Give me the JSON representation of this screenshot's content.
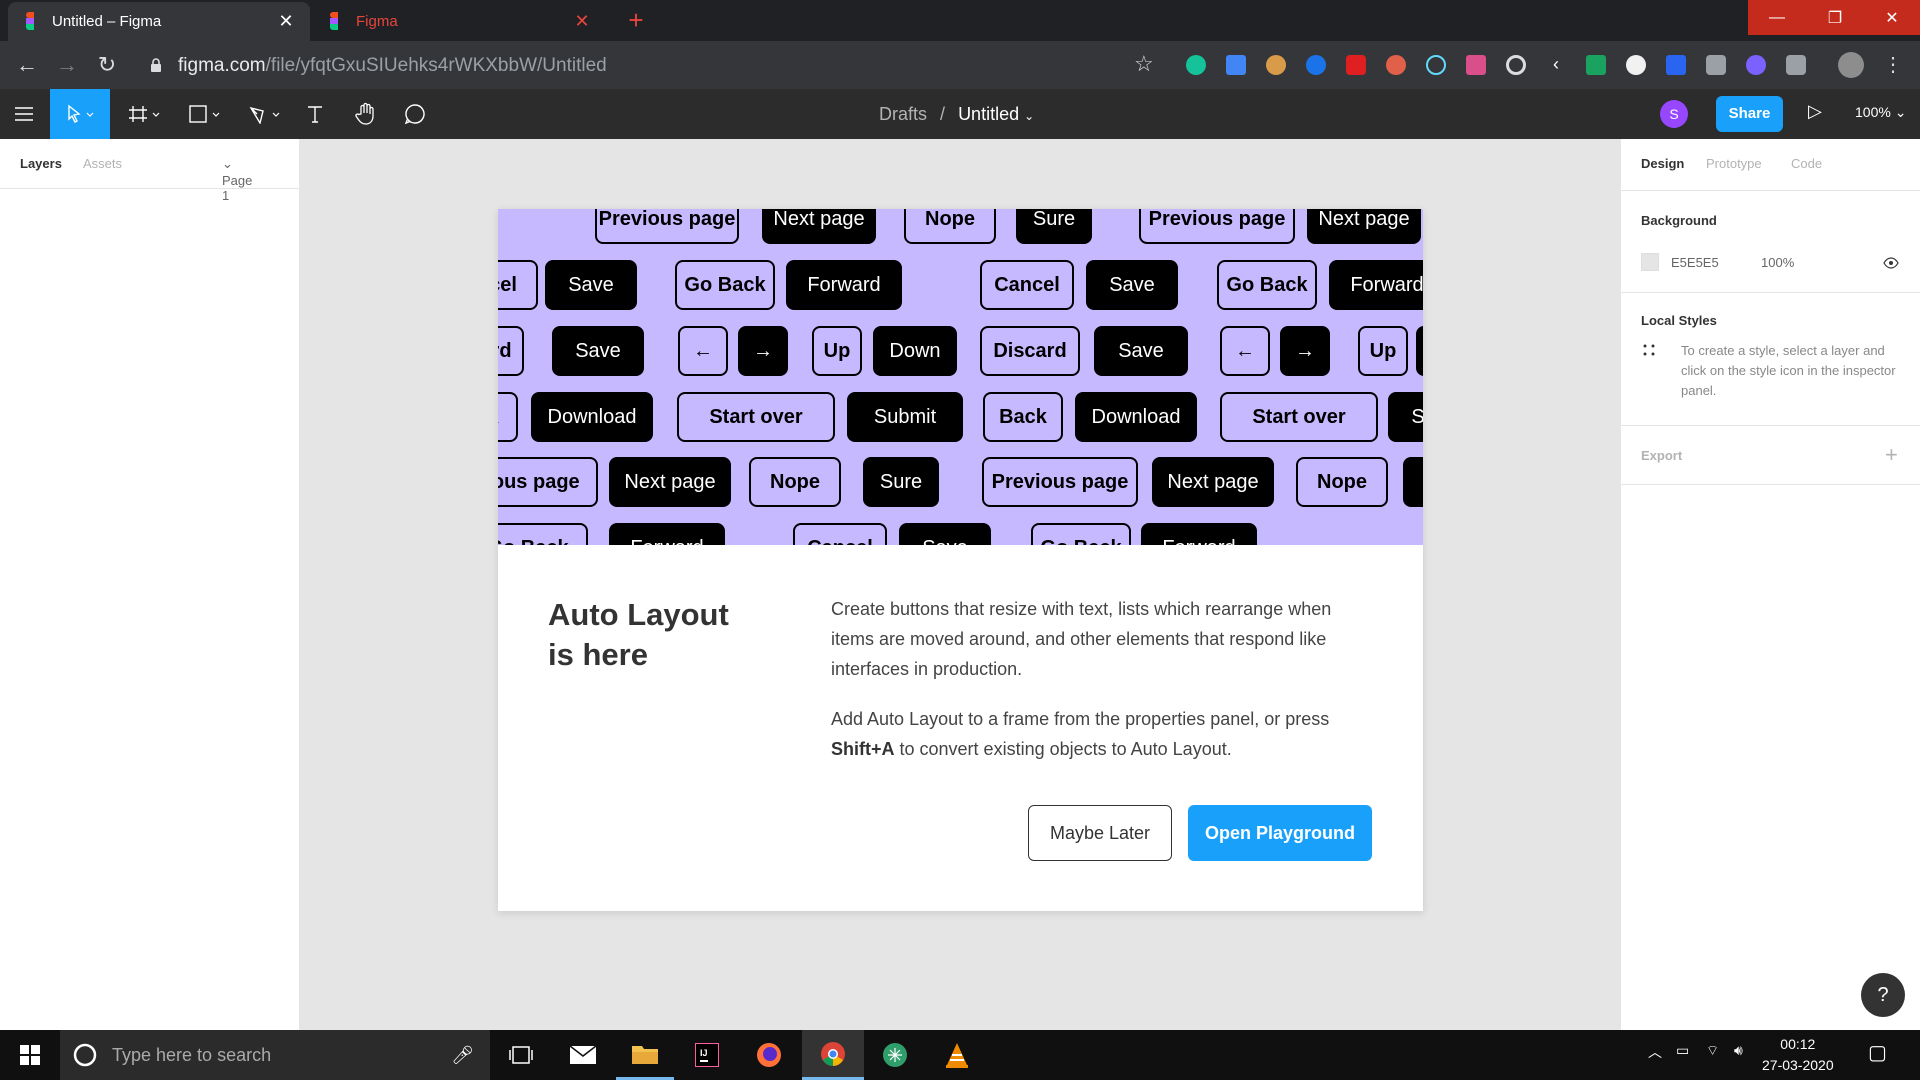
{
  "browser": {
    "tabs": [
      {
        "title": "Untitled – Figma",
        "close": "✕"
      },
      {
        "title": "Figma",
        "close": "✕"
      }
    ],
    "new_tab": "+",
    "url_host": "figma.com",
    "url_path": "/file/yfqtGxuSIUehks4rWKXbbW/Untitled"
  },
  "figma": {
    "breadcrumb_parent": "Drafts",
    "breadcrumb_sep": "/",
    "file_name": "Untitled",
    "avatar_initial": "S",
    "share_label": "Share",
    "zoom": "100%",
    "left_panel": {
      "tab_layers": "Layers",
      "tab_assets": "Assets",
      "page": "Page 1"
    },
    "right_panel": {
      "tab_design": "Design",
      "tab_prototype": "Prototype",
      "tab_code": "Code",
      "background_heading": "Background",
      "background_hex": "E5E5E5",
      "background_opacity": "100%",
      "local_styles_heading": "Local Styles",
      "local_styles_hint": "To create a style, select a layer and click on the style icon in the inspector panel.",
      "export_heading": "Export",
      "export_add": "+"
    },
    "help": "?"
  },
  "dialog": {
    "headline_line1": "Auto Layout",
    "headline_line2": "is here",
    "para1": "Create buttons that resize with text, lists which rearrange when items are moved around, and other elements that respond like interfaces in production.",
    "para2_pre": "Add Auto Layout to a frame from the properties panel, or press ",
    "para2_key": "Shift+A",
    "para2_post": " to convert existing objects to Auto Layout.",
    "btn_later": "Maybe Later",
    "btn_open": "Open Playground",
    "hero_rows": [
      [
        [
          "light",
          "Previous page"
        ],
        [
          "dark",
          "Next page"
        ],
        [
          "light",
          "Nope"
        ],
        [
          "dark",
          "Sure"
        ],
        [
          "light",
          "Previous page"
        ],
        [
          "dark",
          "Next page"
        ]
      ],
      [
        [
          "light",
          "cel"
        ],
        [
          "dark",
          "Save"
        ],
        [
          "light",
          "Go Back"
        ],
        [
          "dark",
          "Forward"
        ],
        [
          "light",
          "Cancel"
        ],
        [
          "dark",
          "Save"
        ],
        [
          "light",
          "Go Back"
        ],
        [
          "dark",
          "Forward"
        ]
      ],
      [
        [
          "light",
          "ard"
        ],
        [
          "dark",
          "Save"
        ],
        [
          "light",
          "←"
        ],
        [
          "dark",
          "→"
        ],
        [
          "light",
          "Up"
        ],
        [
          "dark",
          "Down"
        ],
        [
          "light",
          "Discard"
        ],
        [
          "dark",
          "Save"
        ],
        [
          "light",
          "←"
        ],
        [
          "dark",
          "→"
        ],
        [
          "light",
          "Up"
        ],
        [
          "dark",
          ""
        ]
      ],
      [
        [
          "light",
          "k"
        ],
        [
          "dark",
          "Download"
        ],
        [
          "light",
          "Start over"
        ],
        [
          "dark",
          "Submit"
        ],
        [
          "light",
          "Back"
        ],
        [
          "dark",
          "Download"
        ],
        [
          "light",
          "Start over"
        ],
        [
          "dark",
          "S"
        ]
      ],
      [
        [
          "light",
          "ious page"
        ],
        [
          "dark",
          "Next page"
        ],
        [
          "light",
          "Nope"
        ],
        [
          "dark",
          "Sure"
        ],
        [
          "light",
          "Previous page"
        ],
        [
          "dark",
          "Next page"
        ],
        [
          "light",
          "Nope"
        ],
        [
          "dark",
          ""
        ]
      ],
      [
        [
          "light",
          "Go Back"
        ],
        [
          "dark",
          "Forward"
        ],
        [
          "light",
          "Cancel"
        ],
        [
          "dark",
          "Save"
        ],
        [
          "light",
          "Go Back"
        ],
        [
          "dark",
          "Forward"
        ]
      ]
    ]
  },
  "taskbar": {
    "search_placeholder": "Type here to search",
    "time": "00:12",
    "date": "27-03-2020"
  }
}
